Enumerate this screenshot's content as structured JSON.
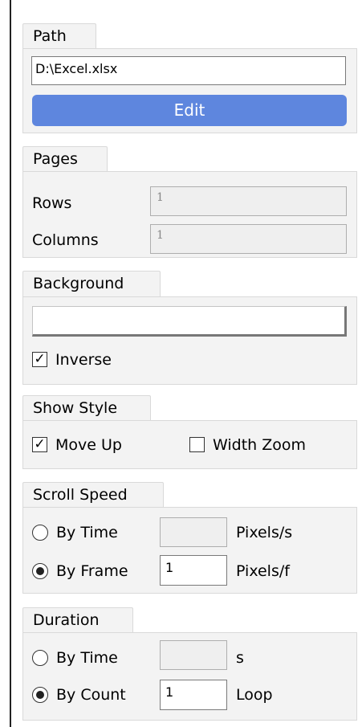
{
  "path": {
    "tab": "Path",
    "value": "D:\\Excel.xlsx",
    "edit_label": "Edit"
  },
  "pages": {
    "tab": "Pages",
    "rows_label": "Rows",
    "rows_value": "1",
    "columns_label": "Columns",
    "columns_value": "1"
  },
  "background": {
    "tab": "Background",
    "inverse_label": "Inverse",
    "inverse_checked": true,
    "inverse_mark": "✓"
  },
  "show_style": {
    "tab": "Show Style",
    "move_up_label": "Move Up",
    "move_up_checked": true,
    "move_up_mark": "✓",
    "width_zoom_label": "Width Zoom",
    "width_zoom_checked": false
  },
  "scroll_speed": {
    "tab": "Scroll Speed",
    "by_time_label": "By Time",
    "by_time_value": "",
    "by_time_unit": "Pixels/s",
    "by_frame_label": "By Frame",
    "by_frame_value": "1",
    "by_frame_unit": "Pixels/f",
    "selected": "By Frame"
  },
  "duration": {
    "tab": "Duration",
    "by_time_label": "By Time",
    "by_time_value": "",
    "by_time_unit": "s",
    "by_count_label": "By Count",
    "by_count_value": "1",
    "by_count_unit": "Loop",
    "selected": "By Count"
  }
}
